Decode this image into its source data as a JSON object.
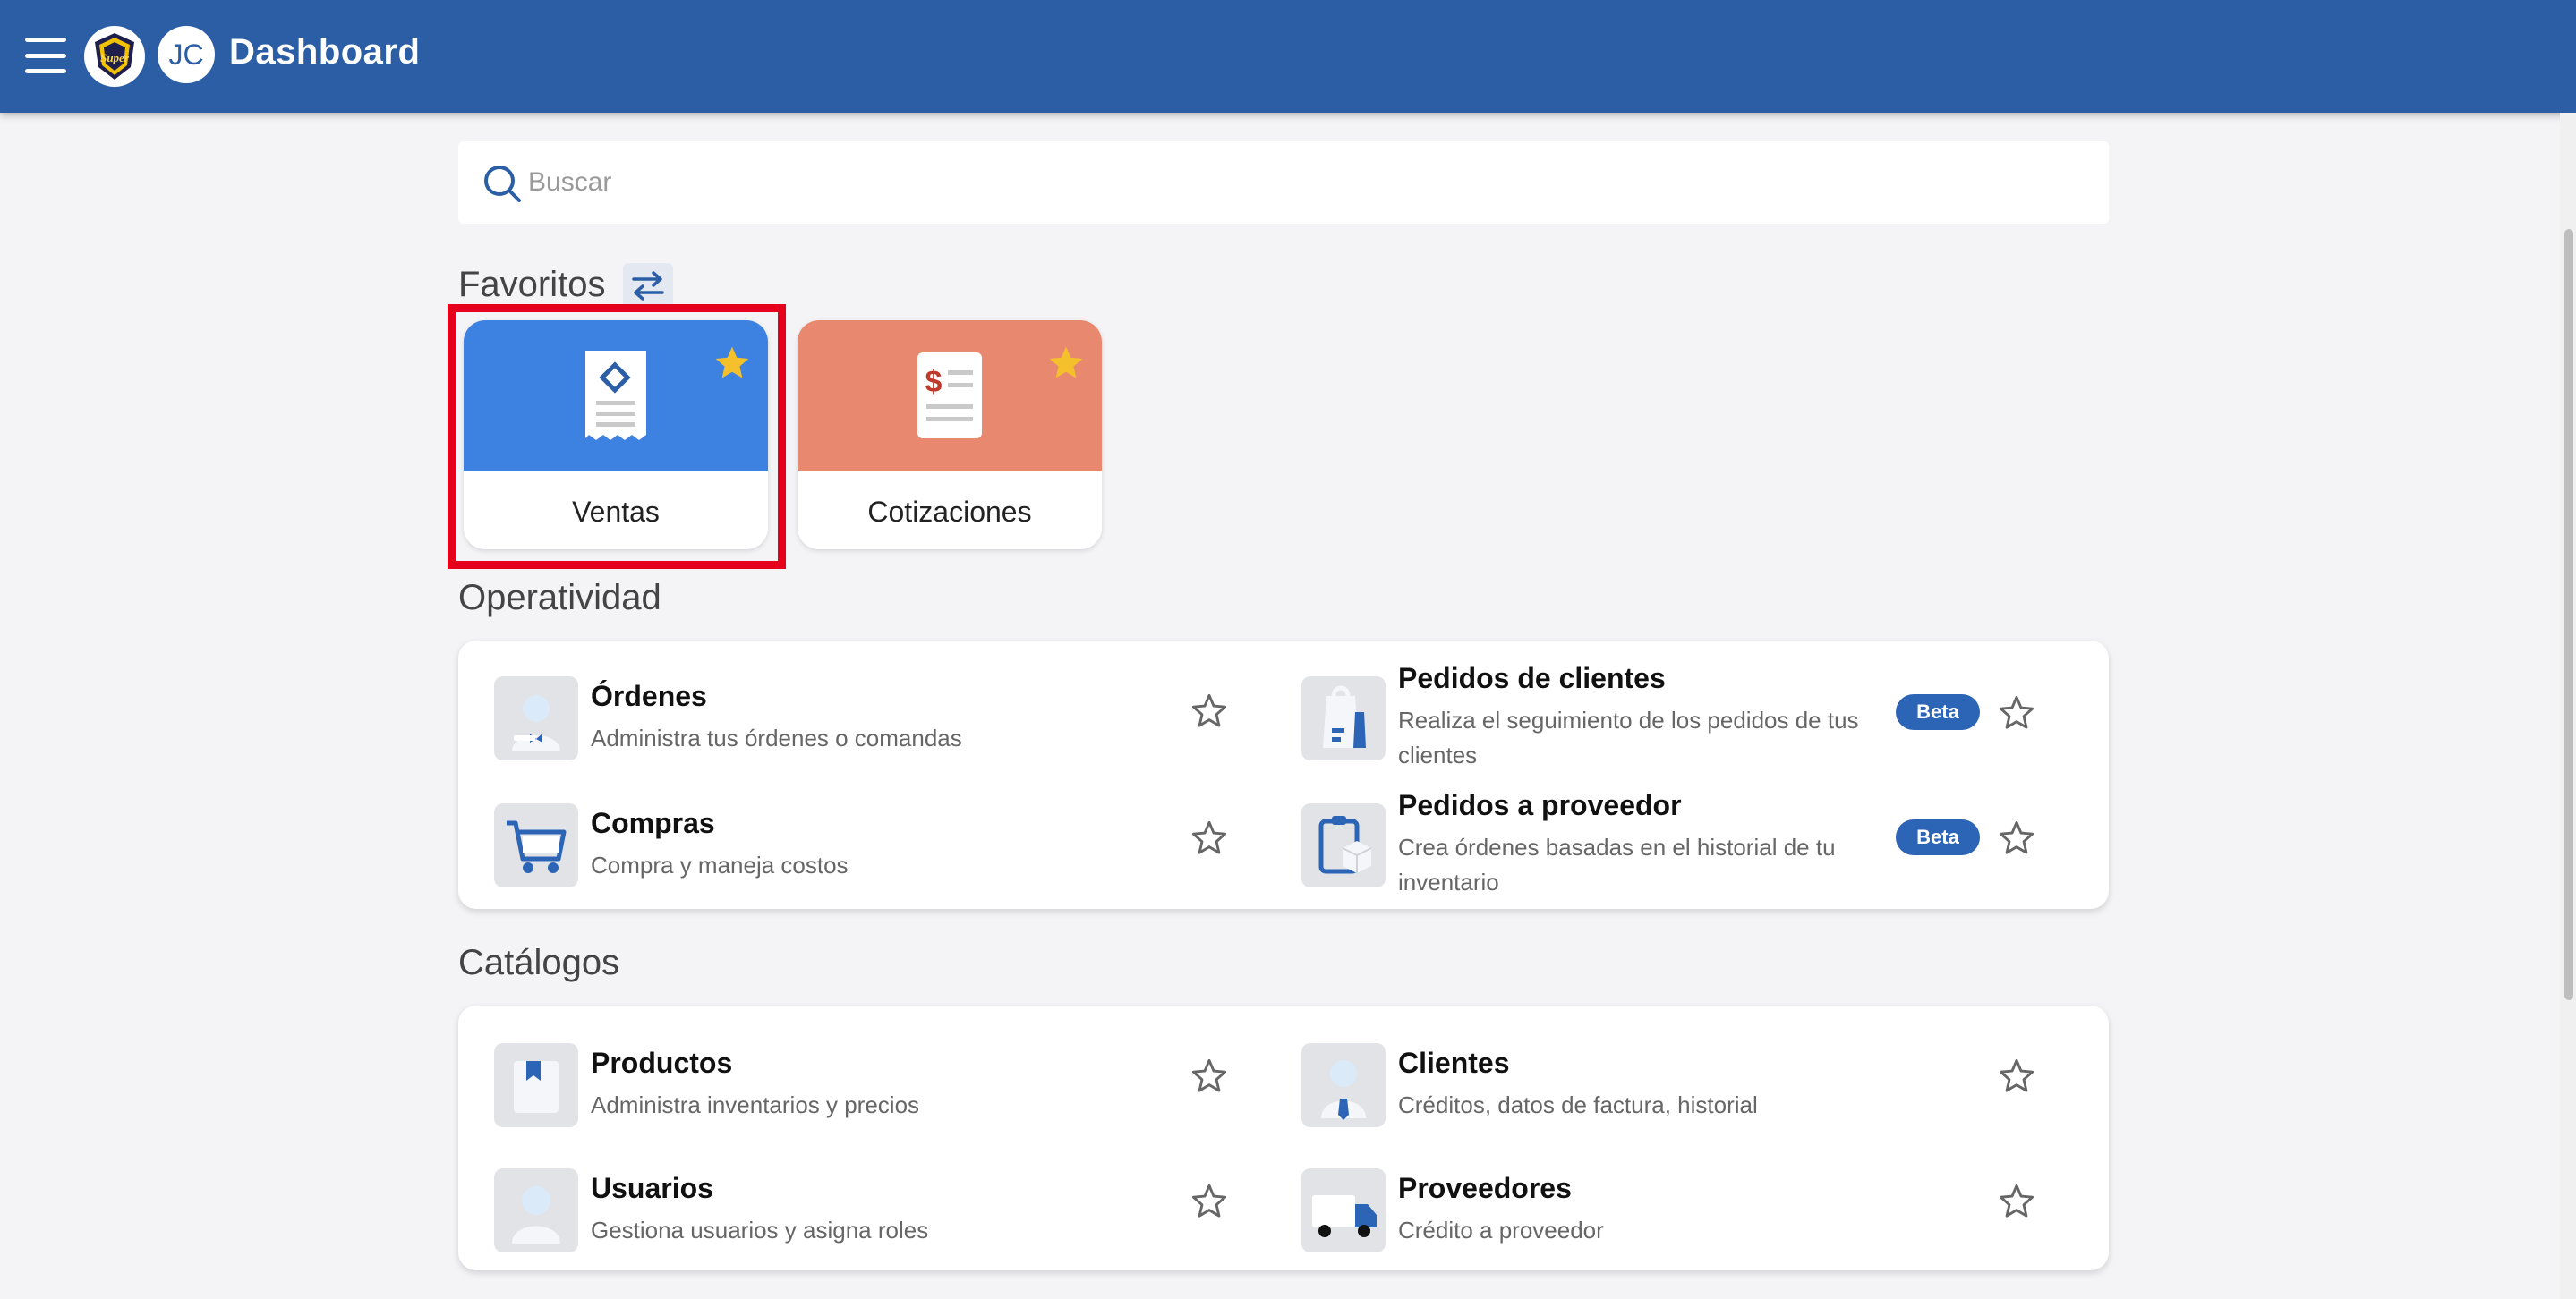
{
  "header": {
    "title": "Dashboard",
    "avatar_initials": "JC",
    "logo_text": "Super",
    "bar_color": "#2c5ea6"
  },
  "search": {
    "placeholder": "Buscar",
    "value": ""
  },
  "favorites": {
    "title": "Favoritos",
    "swap_icon": "swap-arrows-icon",
    "tiles": [
      {
        "label": "Ventas",
        "color": "#3d82e0",
        "icon": "receipt-icon",
        "starred": true
      },
      {
        "label": "Cotizaciones",
        "color": "#e8896f",
        "icon": "quote-document-icon",
        "starred": true
      }
    ],
    "highlighted": "Ventas",
    "highlight_color": "#e5001b"
  },
  "operatividad": {
    "title": "Operatividad",
    "items": [
      {
        "title": "Órdenes",
        "desc": "Administra tus órdenes o comandas",
        "icon": "waiter-icon",
        "beta": false
      },
      {
        "title": "Pedidos de clientes",
        "desc": "Realiza el seguimiento de los pedidos de tus clientes",
        "icon": "shopping-bag-icon",
        "beta": true
      },
      {
        "title": "Compras",
        "desc": "Compra y maneja costos",
        "icon": "cart-icon",
        "beta": false
      },
      {
        "title": "Pedidos a proveedor",
        "desc": "Crea órdenes basadas en el historial de tu inventario",
        "icon": "supplier-box-icon",
        "beta": true
      }
    ]
  },
  "catalogos": {
    "title": "Catálogos",
    "items": [
      {
        "title": "Productos",
        "desc": "Administra inventarios y precios",
        "icon": "product-tag-icon"
      },
      {
        "title": "Clientes",
        "desc": "Créditos, datos de factura, historial",
        "icon": "customer-icon"
      },
      {
        "title": "Usuarios",
        "desc": "Gestiona usuarios y asigna roles",
        "icon": "user-icon"
      },
      {
        "title": "Proveedores",
        "desc": "Crédito a proveedor",
        "icon": "truck-icon"
      }
    ]
  },
  "beta_label": "Beta",
  "star_color": "#f4c02b"
}
